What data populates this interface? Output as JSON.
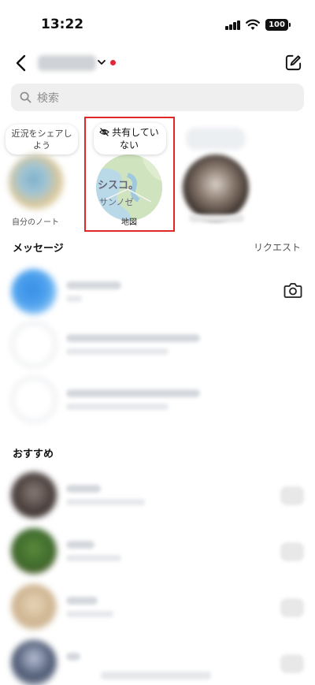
{
  "status_bar": {
    "time": "13:22",
    "battery": "100"
  },
  "header": {
    "username": "username",
    "unread_dot_color": "#e5253a"
  },
  "search": {
    "placeholder": "検索"
  },
  "notes": {
    "self": {
      "bubble": "近況をシェアしよう",
      "label": "自分のノート"
    },
    "map": {
      "bubble": "共有していない",
      "label": "地図",
      "map_text_1": "シスコ。",
      "map_text_2": "サンノゼ",
      "highlight_color": "#e02828"
    },
    "friend": {
      "name": "friend"
    }
  },
  "messages": {
    "title": "メッセージ",
    "requests_label": "リクエスト",
    "rows": [
      {
        "name": "name",
        "subtitle": "subtitle"
      },
      {
        "name": "name",
        "subtitle": "subtitle"
      },
      {
        "name": "name",
        "subtitle": "subtitle"
      }
    ]
  },
  "recommendations": {
    "title": "おすすめ",
    "rows": [
      {
        "name": "name",
        "subtitle": "subtitle"
      },
      {
        "name": "name",
        "subtitle": "subtitle"
      },
      {
        "name": "name",
        "subtitle": "subtitle"
      },
      {
        "name": "name",
        "subtitle": "subtitle"
      }
    ]
  }
}
